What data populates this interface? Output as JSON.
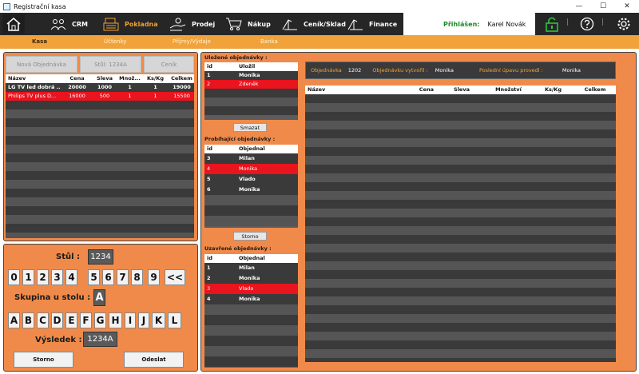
{
  "window": {
    "title": "Registrační kasa",
    "controls": [
      "—",
      "☐",
      "✕"
    ]
  },
  "nav": {
    "items": [
      {
        "label": "CRM",
        "icon": "people-icon"
      },
      {
        "label": "Pokladna",
        "icon": "cash-register-icon",
        "active": true
      },
      {
        "label": "Prodej",
        "icon": "hand-coins-icon"
      },
      {
        "label": "Nákup",
        "icon": "cart-icon"
      },
      {
        "label": "Ceník/Sklad",
        "icon": "barcode-scan-icon"
      },
      {
        "label": "Finance",
        "icon": "finance-icon"
      }
    ],
    "user_label": "Přihlášen:",
    "user_name": "Karel Novák"
  },
  "subnav": [
    "Kasa",
    "Účtenky",
    "Příjmy/Výdaje",
    "Banka"
  ],
  "order": {
    "buttons": {
      "new": "Nová Objednávka",
      "table": "Stůl: 1234A",
      "pricelist": "Ceník"
    },
    "columns": [
      "Název",
      "Cena",
      "Sleva",
      "Množ...",
      "Ks/Kg",
      "Celkem"
    ],
    "rows": [
      [
        "LG TV led dobrá ...",
        "20000",
        "1000",
        "1",
        "1",
        "19000"
      ],
      [
        "Philips TV plus D...",
        "16000",
        "500",
        "1",
        "1",
        "15500"
      ]
    ]
  },
  "keypad": {
    "table_label": "Stůl :",
    "table_value": "1234",
    "digits": [
      "0",
      "1",
      "2",
      "3",
      "4",
      "5",
      "6",
      "7",
      "8",
      "9",
      "<<"
    ],
    "group_label": "Skupina u stolu :",
    "group_value": "A",
    "letters": [
      "A",
      "B",
      "C",
      "D",
      "E",
      "F",
      "G",
      "H",
      "I",
      "J",
      "K",
      "L"
    ],
    "result_label": "Výsledek :",
    "result_value": "1234A",
    "cancel": "Storno",
    "send": "Odeslat"
  },
  "saved": {
    "title": "Uložené objednávky :",
    "columns": [
      "id",
      "Uložil"
    ],
    "rows": [
      [
        "1",
        "Monika"
      ],
      [
        "2",
        "Zdeněk"
      ]
    ],
    "delete": "Smazat"
  },
  "running": {
    "title": "Probíhající objednávky :",
    "columns": [
      "id",
      "Objednal"
    ],
    "rows": [
      [
        "3",
        "Milan"
      ],
      [
        "4",
        "Monika"
      ],
      [
        "5",
        "Vlado"
      ],
      [
        "6",
        "Monika"
      ]
    ],
    "cancel": "Storno"
  },
  "closed": {
    "title": "Uzavřené objednávky :",
    "columns": [
      "id",
      "Objednal"
    ],
    "rows": [
      [
        "1",
        "Milan"
      ],
      [
        "2",
        "Monika"
      ],
      [
        "3",
        "Vlado"
      ],
      [
        "4",
        "Monika"
      ]
    ]
  },
  "detail": {
    "order_label": "Objednávka",
    "order_no": "1202",
    "created_label": "Objednávku vytvořil :",
    "created_by": "Monika",
    "edited_label": "Poslední úpavu provedl :",
    "edited_by": "Monika",
    "columns": [
      "Název",
      "Cena",
      "Sleva",
      "Množství",
      "Ks/Kg",
      "Celkem"
    ]
  },
  "colors": {
    "accent": "#f2a23a",
    "panel": "#f08a4a",
    "selected": "#e8141e",
    "nav": "#262626"
  }
}
